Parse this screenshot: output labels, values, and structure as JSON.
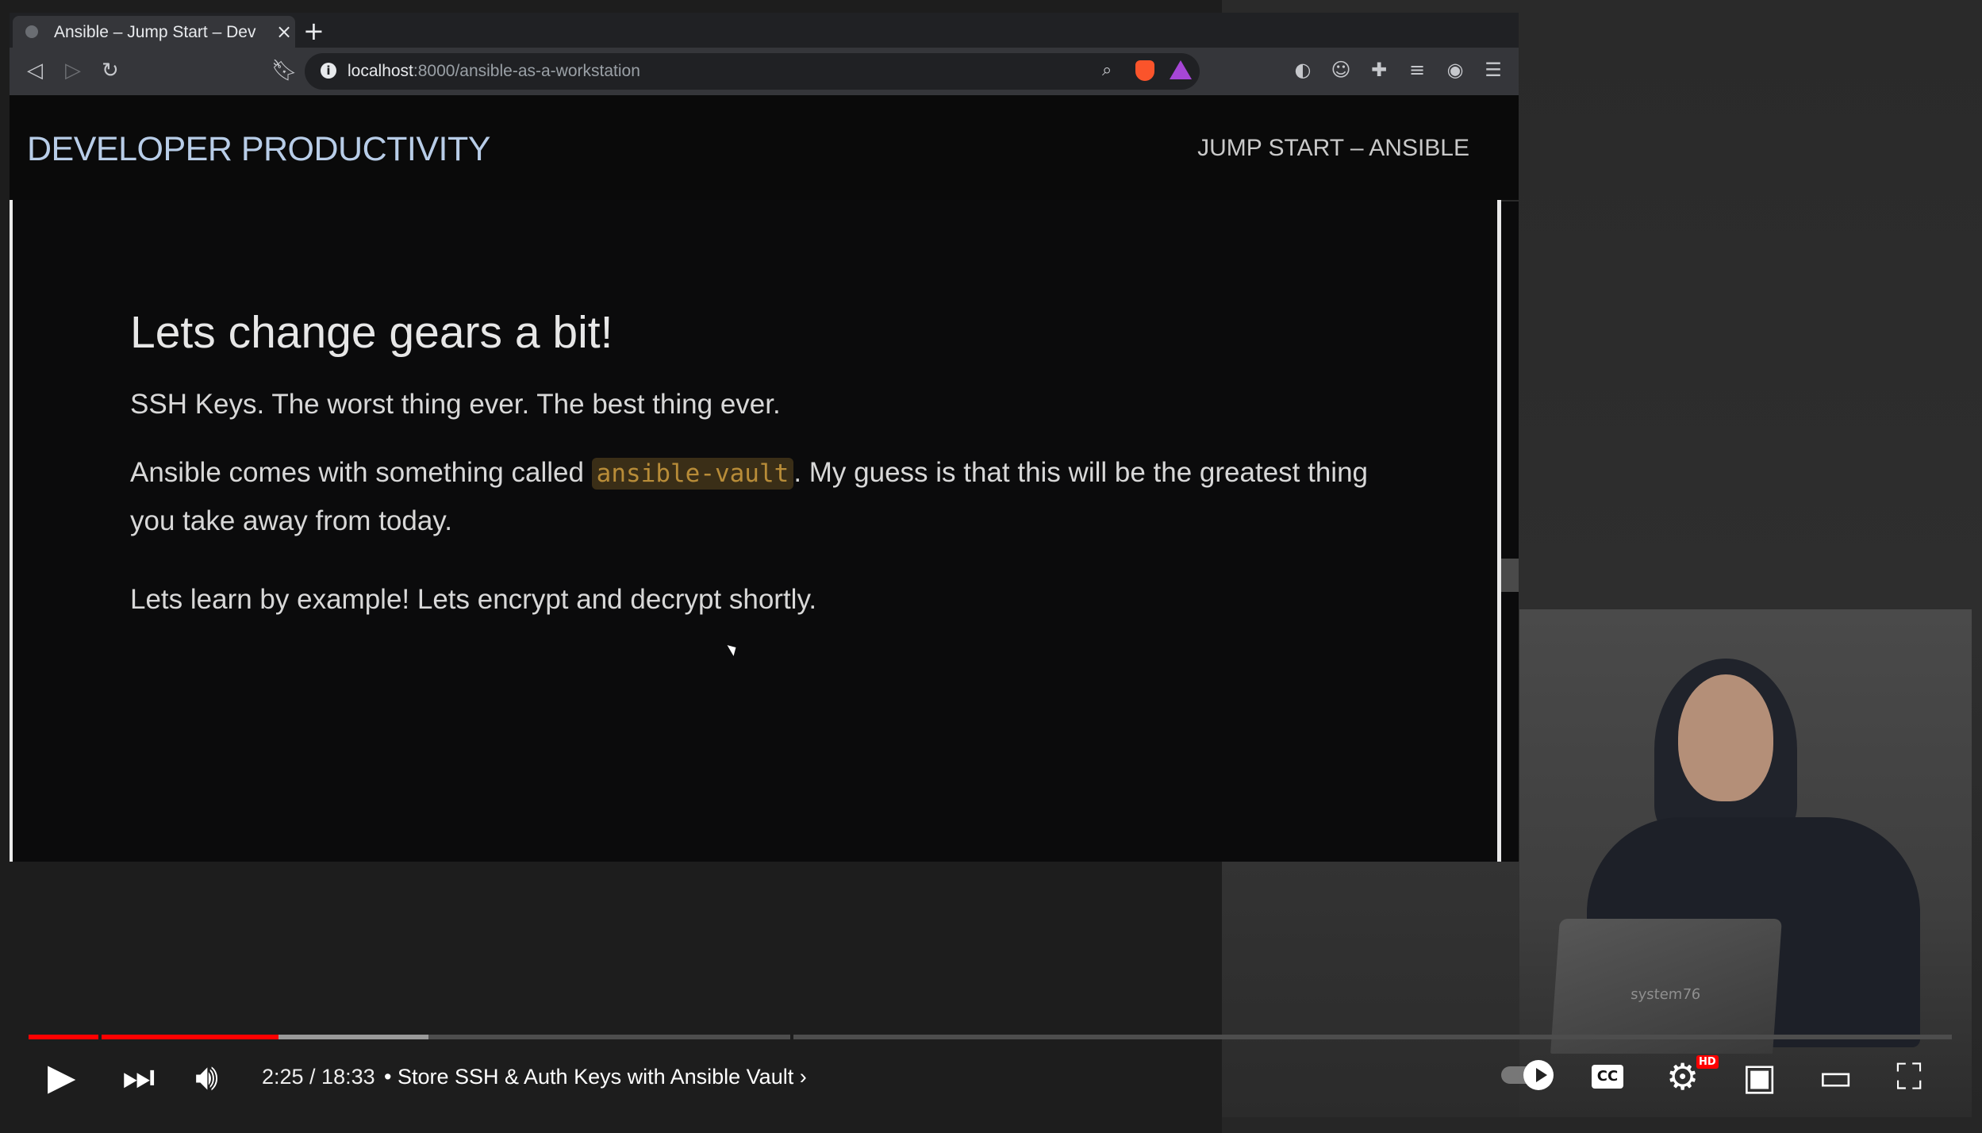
{
  "browser": {
    "tab_title": "Ansible – Jump Start – Dev",
    "url_host": "localhost",
    "url_path": ":8000/ansible-as-a-workstation"
  },
  "site": {
    "brand": "DEVELOPER PRODUCTIVITY",
    "nav_link": "JUMP START – ANSIBLE"
  },
  "slide": {
    "heading": "Lets change gears a bit!",
    "p1": "SSH Keys. The worst thing ever. The best thing ever.",
    "p2_before": "Ansible comes with something called ",
    "p2_code": "ansible-vault",
    "p2_after": ". My guess is that this will be the greatest thing you take away from today.",
    "p3": "Lets learn by example! Lets encrypt and decrypt shortly."
  },
  "player": {
    "time": "2:25 / 18:33",
    "chapter": "• Store SSH & Auth Keys with Ansible Vault",
    "progress_fraction": 0.13,
    "buffered_fraction": 0.208,
    "cc_label": "CC",
    "hd_badge": "HD"
  },
  "webcam": {
    "laptop_logo": "system76"
  }
}
